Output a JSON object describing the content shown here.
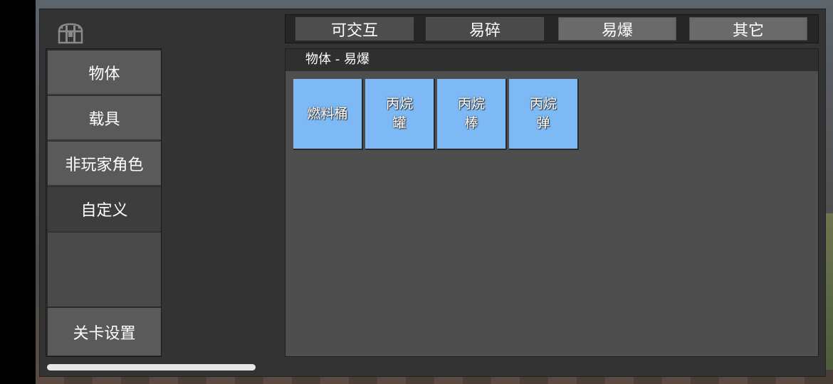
{
  "icons": {
    "chest": "treasure-chest-icon"
  },
  "colors": {
    "item_card": "#7cb9f5",
    "panel": "#333333"
  },
  "sidebar": {
    "items": [
      {
        "label": "物体"
      },
      {
        "label": "载具"
      },
      {
        "label": "非玩家角色"
      },
      {
        "label": "自定义"
      }
    ],
    "bottom": {
      "label": "关卡设置"
    }
  },
  "tabs": [
    {
      "label": "可交互"
    },
    {
      "label": "易碎"
    },
    {
      "label": "易爆"
    },
    {
      "label": "其它"
    }
  ],
  "content": {
    "header": "物体 - 易爆",
    "items": [
      {
        "label": "燃料桶"
      },
      {
        "label": "丙烷\n罐"
      },
      {
        "label": "丙烷\n棒"
      },
      {
        "label": "丙烷\n弹"
      }
    ]
  }
}
